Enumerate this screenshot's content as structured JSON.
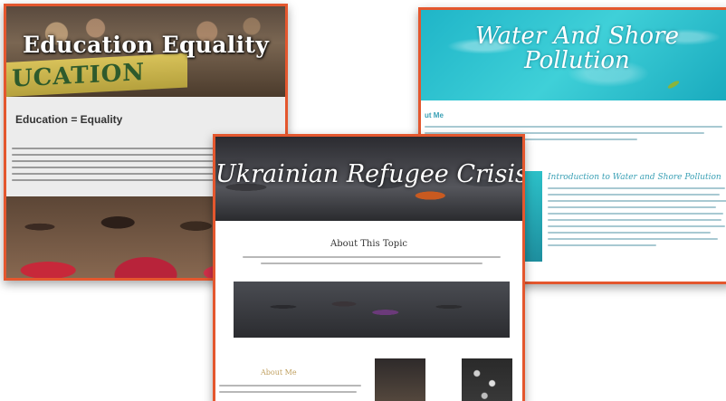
{
  "cards": {
    "education": {
      "banner_title": "Education Equality",
      "banner_sign_text": "UCATION",
      "heading": "Education = Equality"
    },
    "water": {
      "banner_title": "Water And Shore Pollution",
      "section_label": "ut Me",
      "intro_heading": "Introduction to Water and Shore Pollution"
    },
    "ukrainian": {
      "banner_title": "Ukrainian Refugee Crisis",
      "about_topic": "About This Topic",
      "about_me": "About Me"
    }
  }
}
